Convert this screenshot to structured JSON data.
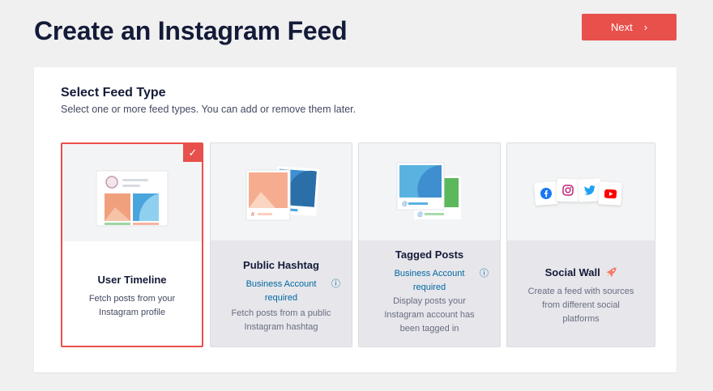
{
  "header": {
    "title": "Create an Instagram Feed",
    "next_label": "Next",
    "next_chevron": "›"
  },
  "section": {
    "title": "Select Feed Type",
    "subtitle": "Select one or more feed types. You can add or remove them later."
  },
  "cards": [
    {
      "title": "User Timeline",
      "desc_lines": [
        "Fetch posts from your",
        "Instagram profile"
      ],
      "selected": true,
      "check": "✓"
    },
    {
      "title": "Public Hashtag",
      "req_lines": [
        "Business Account",
        "required"
      ],
      "desc_lines": [
        "Fetch posts from a public",
        "Instagram hashtag"
      ],
      "selected": false,
      "hash_symbol": "#"
    },
    {
      "title": "Tagged Posts",
      "req_lines": [
        "Business Account",
        "required"
      ],
      "desc_lines": [
        "Display posts your",
        "Instagram account has",
        "been tagged in"
      ],
      "selected": false,
      "at_symbol": "@"
    },
    {
      "title": "Social Wall",
      "title_icon": "🚀",
      "desc_lines": [
        "Create a feed with sources",
        "from different social",
        "platforms"
      ],
      "selected": false,
      "icons": [
        "facebook-icon",
        "instagram-icon",
        "twitter-icon",
        "youtube-icon"
      ]
    }
  ],
  "info_glyph": "ⓘ",
  "colors": {
    "accent": "#e8504b",
    "link": "#0068a0",
    "title": "#141b38"
  }
}
